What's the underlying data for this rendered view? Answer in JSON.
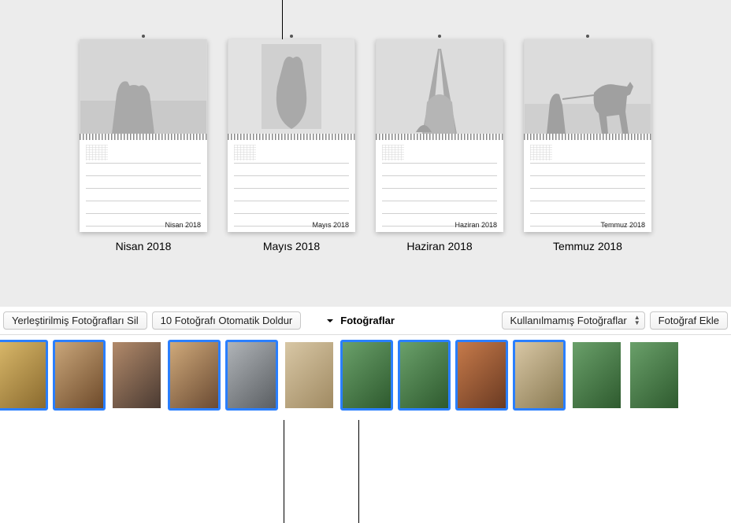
{
  "months": [
    {
      "inline": "Nisan 2018",
      "label": "Nisan 2018"
    },
    {
      "inline": "Mayıs 2018",
      "label": "Mayıs 2018"
    },
    {
      "inline": "Haziran 2018",
      "label": "Haziran 2018"
    },
    {
      "inline": "Temmuz 2018",
      "label": "Temmuz 2018"
    }
  ],
  "toolbar": {
    "clear_placed": "Yerleştirilmiş Fotoğrafları Sil",
    "autofill": "10 Fotoğrafı Otomatik Doldur",
    "photos_label": "Fotoğraflar",
    "filter": "Kullanılmamış Fotoğraflar",
    "add_photo": "Fotoğraf Ekle"
  },
  "thumbs": [
    {
      "selected": true,
      "name": "photo-dog-crown",
      "bg": "linear-gradient(135deg,#d9b86a,#8a6a2e)"
    },
    {
      "selected": true,
      "name": "photo-dog-scarf",
      "bg": "linear-gradient(135deg,#c9a67a,#6e4a2a)"
    },
    {
      "selected": false,
      "name": "photo-woman-curly",
      "bg": "linear-gradient(135deg,#b28a6a,#4a3a32)"
    },
    {
      "selected": true,
      "name": "photo-woman-smile",
      "bg": "linear-gradient(135deg,#cfa97a,#6a4a32)"
    },
    {
      "selected": true,
      "name": "photo-dog-table",
      "bg": "linear-gradient(135deg,#b0b4b8,#5a5e62)"
    },
    {
      "selected": false,
      "name": "photo-dog-blanket",
      "bg": "linear-gradient(135deg,#d8c7a5,#a08a62)"
    },
    {
      "selected": true,
      "name": "photo-girl-hammock",
      "bg": "linear-gradient(135deg,#6aa06a,#2e5a2e)"
    },
    {
      "selected": true,
      "name": "photo-girl-hammock2",
      "bg": "linear-gradient(135deg,#6aa06a,#2e5a2e)"
    },
    {
      "selected": true,
      "name": "photo-dog-hat",
      "bg": "linear-gradient(135deg,#c67a4a,#6a3a22)"
    },
    {
      "selected": true,
      "name": "photo-dog-bag",
      "bg": "linear-gradient(135deg,#d8c7a5,#8a7a52)"
    },
    {
      "selected": false,
      "name": "photo-dog-river",
      "bg": "linear-gradient(135deg,#6aa06a,#2e5a2e)"
    },
    {
      "selected": false,
      "name": "photo-dog-water",
      "bg": "linear-gradient(135deg,#6aa06a,#2e5a2e)"
    }
  ]
}
